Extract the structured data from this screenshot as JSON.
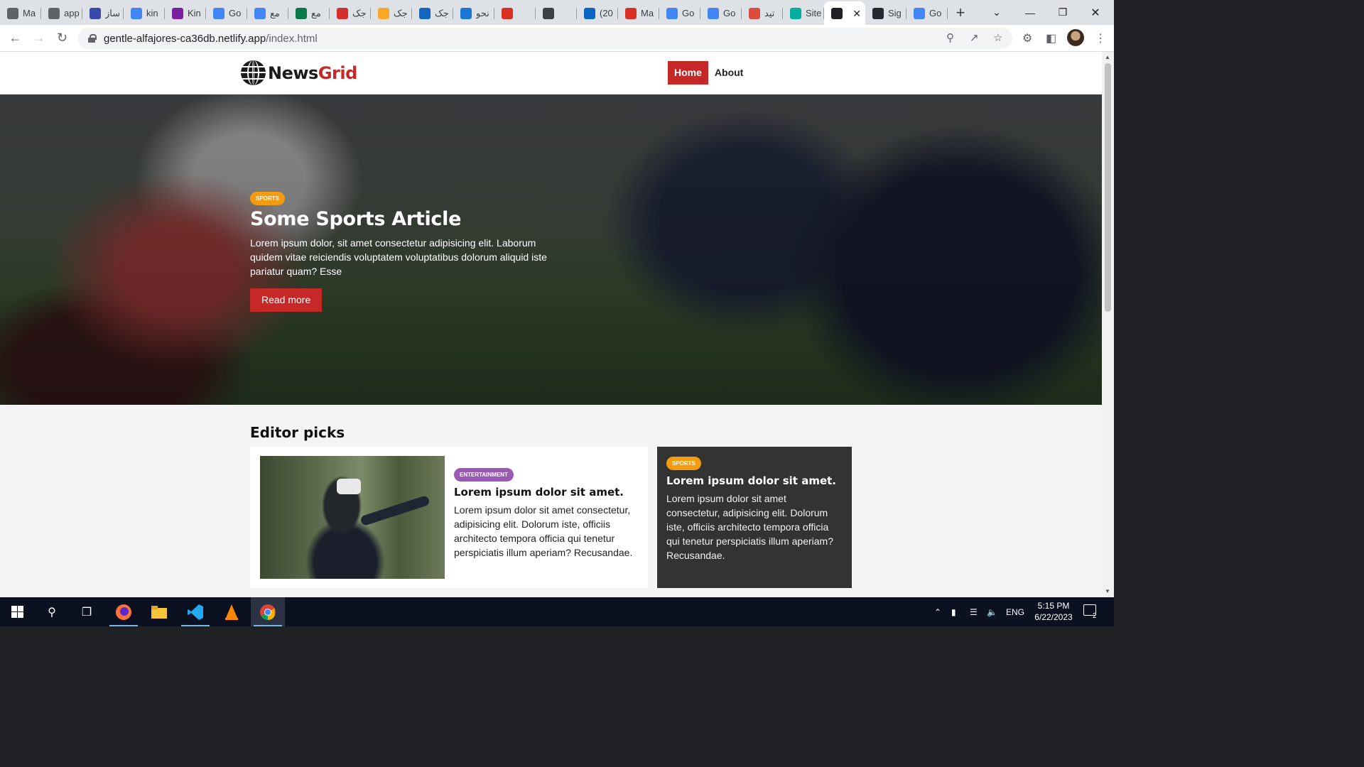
{
  "browser": {
    "tabs": [
      {
        "title": "Ma",
        "icon": "globe-icon",
        "color": "#5f6368"
      },
      {
        "title": "app",
        "icon": "globe-icon",
        "color": "#5f6368"
      },
      {
        "title": "ساز",
        "icon": "target-icon",
        "color": "#3949ab"
      },
      {
        "title": "kin",
        "icon": "google-icon",
        "color": "#4285f4"
      },
      {
        "title": "Kin",
        "icon": "k-icon",
        "color": "#7b1fa2"
      },
      {
        "title": "Go",
        "icon": "google-translate-icon",
        "color": "#4285f4"
      },
      {
        "title": "مع",
        "icon": "google-icon",
        "color": "#4285f4"
      },
      {
        "title": "مع",
        "icon": "green-book-icon",
        "color": "#0b7a4b"
      },
      {
        "title": "جک",
        "icon": "dots-icon",
        "color": "#d32f2f"
      },
      {
        "title": "جک",
        "icon": "sun-icon",
        "color": "#f9a825"
      },
      {
        "title": "جک",
        "icon": "check-icon",
        "color": "#1565c0"
      },
      {
        "title": "نحو",
        "icon": "translate-icon",
        "color": "#1976d2"
      },
      {
        "title": "",
        "icon": "gmail-icon",
        "color": "#d93025"
      },
      {
        "title": "",
        "icon": "inbox-icon",
        "color": "#3c4043"
      },
      {
        "title": "(20",
        "icon": "linkedin-icon",
        "color": "#0a66c2"
      },
      {
        "title": "Ma",
        "icon": "gmail-icon",
        "color": "#d93025"
      },
      {
        "title": "Go",
        "icon": "google-translate-icon",
        "color": "#4285f4"
      },
      {
        "title": "Go",
        "icon": "google-translate-icon",
        "color": "#4285f4"
      },
      {
        "title": "تید",
        "icon": "todo-icon",
        "color": "#db4c3f"
      },
      {
        "title": "Site",
        "icon": "netlify-icon",
        "color": "#00ad9f"
      },
      {
        "title": "",
        "icon": "globe-icon",
        "color": "#202124",
        "active": true
      },
      {
        "title": "Sig",
        "icon": "github-icon",
        "color": "#24292f"
      },
      {
        "title": "Go",
        "icon": "google-translate-icon",
        "color": "#4285f4"
      }
    ],
    "new_tab_label": "+",
    "url_host": "gentle-alfajores-ca36db.netlify.app",
    "url_path": "/index.html"
  },
  "site": {
    "logo_part1": "News",
    "logo_part2": "Grid",
    "nav": [
      {
        "label": "Home",
        "active": true
      },
      {
        "label": "About",
        "active": false
      }
    ],
    "hero": {
      "badge": "SPORTS",
      "title": "Some Sports Article",
      "text": "Lorem ipsum dolor, sit amet consectetur adipisicing elit. Laborum quidem vitae reiciendis voluptatem voluptatibus dolorum aliquid iste pariatur quam? Esse",
      "button": "Read more"
    },
    "editor_picks": {
      "title": "Editor picks",
      "main_card": {
        "badge": "ENTERTAINMENT",
        "title": "Lorem ipsum dolor sit amet.",
        "text": "Lorem ipsum dolor sit amet consectetur, adipisicing elit. Dolorum iste, officiis architecto tempora officia qui tenetur perspiciatis illum aperiam? Recusandae."
      },
      "side_card": {
        "badge": "SPORTS",
        "title": "Lorem ipsum dolor sit amet.",
        "text": "Lorem ipsum dolor sit amet consectetur, adipisicing elit. Dolorum iste, officiis architecto tempora officia qui tenetur perspiciatis illum aperiam? Recusandae."
      }
    },
    "colors": {
      "accent": "#c62828",
      "sports": "#f39c12",
      "entertainment": "#9b59b6",
      "dark_card": "#333333"
    }
  },
  "taskbar": {
    "apps": [
      "start-icon",
      "search-icon",
      "task-view-icon",
      "firefox-icon",
      "file-explorer-icon",
      "vscode-icon",
      "vlc-icon",
      "chrome-icon"
    ],
    "language": "ENG",
    "time": "5:15 PM",
    "date": "6/22/2023",
    "notifications": "2"
  }
}
